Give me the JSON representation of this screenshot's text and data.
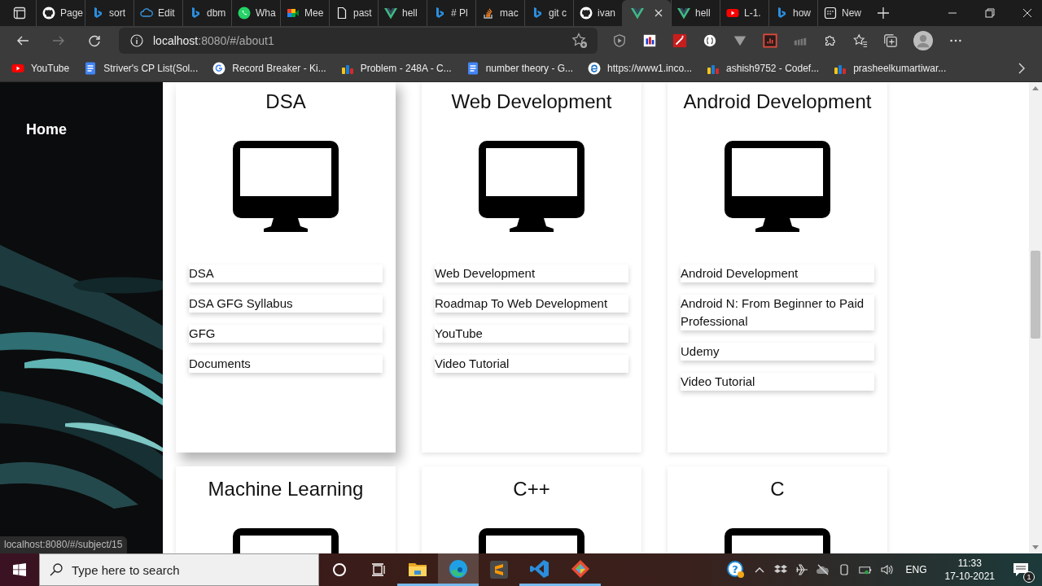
{
  "tabs": [
    {
      "title": "Page",
      "kind": "github",
      "selected": false
    },
    {
      "title": "sort",
      "kind": "bing",
      "selected": false
    },
    {
      "title": "Edit",
      "kind": "cloud",
      "selected": false
    },
    {
      "title": "dbm",
      "kind": "bing",
      "selected": false
    },
    {
      "title": "Wha",
      "kind": "whatsapp",
      "selected": false
    },
    {
      "title": "Mee",
      "kind": "meet",
      "selected": false
    },
    {
      "title": "past",
      "kind": "file",
      "selected": false
    },
    {
      "title": "hell",
      "kind": "vue",
      "selected": false
    },
    {
      "title": "# Pl",
      "kind": "bing",
      "selected": false
    },
    {
      "title": "mac",
      "kind": "stack",
      "selected": false
    },
    {
      "title": "git c",
      "kind": "bing",
      "selected": false
    },
    {
      "title": "ivan",
      "kind": "github",
      "selected": false
    },
    {
      "kind": "vue",
      "selected": true
    },
    {
      "title": "hell",
      "kind": "vue",
      "selected": false
    },
    {
      "title": "L-1.",
      "kind": "youtube",
      "selected": false
    },
    {
      "title": "how",
      "kind": "bing",
      "selected": false
    },
    {
      "title": "New",
      "kind": "newtab",
      "selected": false
    }
  ],
  "address": {
    "host": "localhost",
    "path": ":8080/#/about1"
  },
  "bookmarks": [
    {
      "title": "YouTube",
      "kind": "youtube"
    },
    {
      "title": "Striver's CP List(Sol...",
      "kind": "doc"
    },
    {
      "title": "Record Breaker - Ki...",
      "kind": "google"
    },
    {
      "title": "Problem - 248A - C...",
      "kind": "chart"
    },
    {
      "title": "number theory - G...",
      "kind": "doc"
    },
    {
      "title": "https://www1.inco...",
      "kind": "edge"
    },
    {
      "title": "ashish9752 - Codef...",
      "kind": "chart"
    },
    {
      "title": "prasheelkumartiwar...",
      "kind": "chart"
    }
  ],
  "sidebar": {
    "items": [
      "Home"
    ]
  },
  "cards": [
    {
      "title": "DSA",
      "raised": true,
      "links": [
        "DSA",
        "DSA GFG Syllabus",
        "GFG",
        "Documents"
      ]
    },
    {
      "title": "Web Development",
      "raised": false,
      "links": [
        "Web Development",
        "Roadmap To Web Development",
        "YouTube",
        "Video Tutorial"
      ]
    },
    {
      "title": "Android Development",
      "raised": false,
      "links": [
        "Android Development",
        "Android N: From Beginner to Paid Professional",
        "Udemy",
        "Video Tutorial"
      ]
    },
    {
      "title": "Machine Learning",
      "raised": false
    },
    {
      "title": "C++",
      "raised": false
    },
    {
      "title": "C",
      "raised": false
    }
  ],
  "status_url": "localhost:8080/#/subject/15",
  "taskbar": {
    "search": {
      "placeholder": "Type here to search"
    },
    "apps": [
      {
        "kind": "explorer",
        "running": true,
        "selected": false
      },
      {
        "kind": "edge",
        "running": true,
        "selected": true
      },
      {
        "kind": "sublime",
        "running": false,
        "selected": false
      },
      {
        "kind": "vscode",
        "running": true,
        "selected": false
      },
      {
        "kind": "git",
        "running": true,
        "selected": false
      }
    ],
    "help_mark": "?",
    "language": "ENG",
    "time": "11:33",
    "date": "17-10-2021",
    "notifications": "1"
  }
}
